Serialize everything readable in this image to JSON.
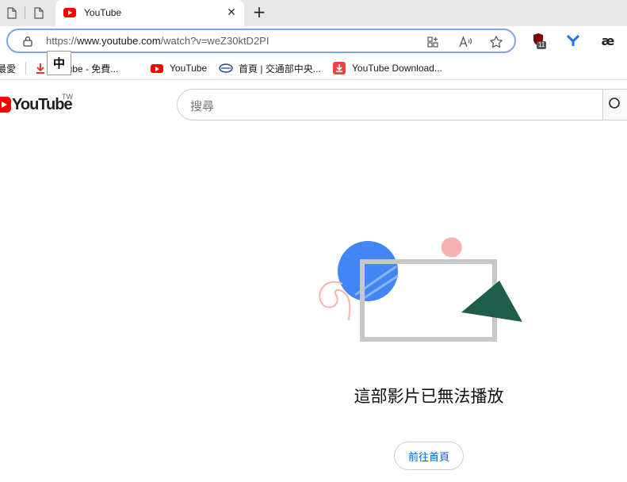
{
  "browser": {
    "tab": {
      "title": "YouTube"
    },
    "new_tab_symbol": "+",
    "close_symbol": "✕",
    "omnibox": {
      "url_scheme": "https://",
      "url_host": "www.youtube.com",
      "url_path": "/watch?v=weZ30ktD2PI"
    },
    "extensions": {
      "ublock_badge": "11",
      "ae_label": "æ"
    },
    "bookmarks": [
      {
        "label": "最愛"
      },
      {
        "label": "Youtube - 免費..."
      },
      {
        "label": "YouTube"
      },
      {
        "label": "首頁 | 交通部中央..."
      },
      {
        "label": "YouTube Download..."
      }
    ],
    "ime_indicator": "中"
  },
  "youtube": {
    "wordmark": "YouTube",
    "region": "TW",
    "search_placeholder": "搜尋",
    "error_message": "這部影片已無法播放",
    "home_button": "前往首頁"
  },
  "colors": {
    "youtube_red": "#ff0000",
    "link_blue": "#065fd4",
    "focus_ring": "#7fa6dd"
  },
  "icons": [
    "page-icon",
    "lock-icon",
    "app-grid-icon",
    "read-aloud-icon",
    "favorite-star-icon",
    "ublock-origin-icon",
    "extension-y-icon",
    "search-icon",
    "download-icon",
    "youtube-icon",
    "gov-logo-icon"
  ]
}
